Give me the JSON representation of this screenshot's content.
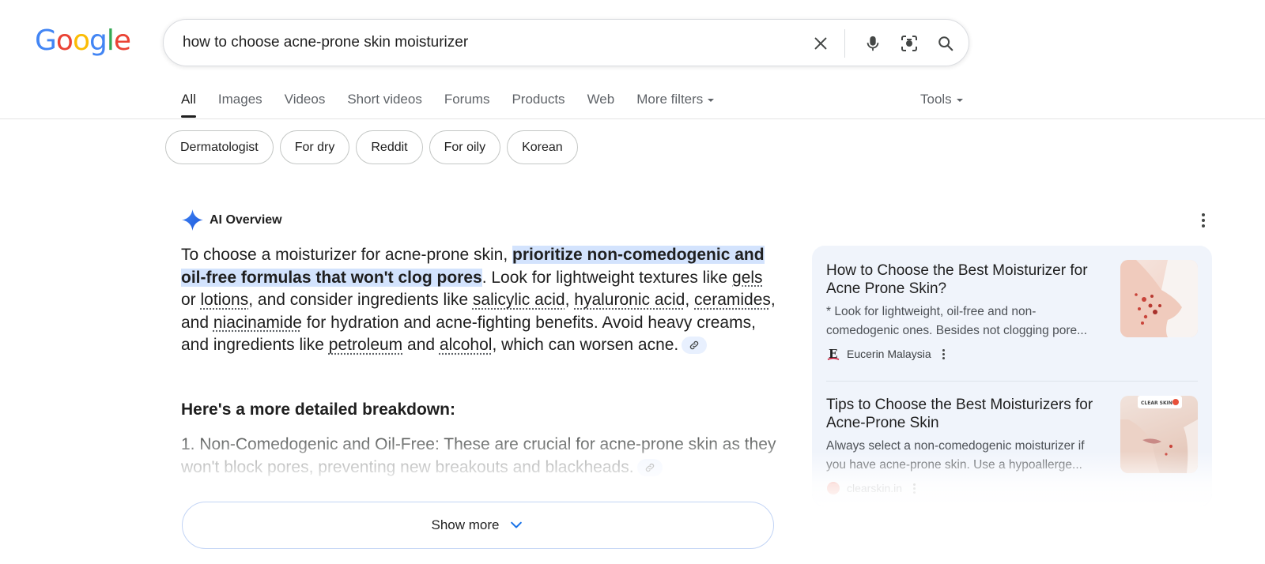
{
  "logo": {
    "letters": [
      "G",
      "o",
      "o",
      "g",
      "l",
      "e"
    ],
    "colors": [
      "#4285F4",
      "#EA4335",
      "#FBBC05",
      "#4285F4",
      "#34A853",
      "#EA4335"
    ]
  },
  "search": {
    "query": "how to choose acne-prone skin moisturizer",
    "icons": [
      "close-icon",
      "mic-icon",
      "lens-icon",
      "search-icon"
    ]
  },
  "tabs": [
    "All",
    "Images",
    "Videos",
    "Short videos",
    "Forums",
    "Products",
    "Web",
    "More filters"
  ],
  "tools_label": "Tools",
  "chips": [
    "Dermatologist",
    "For dry",
    "Reddit",
    "For oily",
    "Korean"
  ],
  "ai_overview": {
    "title": "AI Overview",
    "intro": "To choose a moisturizer for acne-prone skin, ",
    "highlight": "prioritize non-comedogenic and oil-free formulas that won't clog pores",
    "p1": ". Look for lightweight textures like ",
    "gels": "gels",
    "or": " or ",
    "lotions": "lotions",
    "p2": ", and consider ingredients like ",
    "salicylic": "salicylic acid",
    "comma1": ", ",
    "hyaluronic": "hyaluronic acid",
    "comma2": ", ",
    "ceramides": "ceramides",
    "and1": ", and ",
    "niacinamide": "niacinamide",
    "p3": " for hydration and acne-fighting benefits. Avoid heavy creams, and ingredients like ",
    "petroleum": "petroleum",
    "and2": " and ",
    "alcohol": "alcohol",
    "p4": ", which can worsen acne.",
    "subheading": "Here's a more detailed breakdown:",
    "item1": "1. Non-Comedogenic and Oil-Free: These are crucial for acne-prone skin as they won't block pores, preventing new breakouts and blackheads.",
    "show_more": "Show more",
    "accent": "#1a73e8",
    "highlight_bg": "#d3e3fd"
  },
  "sources": [
    {
      "title": "How to Choose the Best Moisturizer for Acne Prone Skin?",
      "snippet_l1": "* Look for lightweight, oil-free and non-",
      "snippet_l2": "comedogenic ones. Besides not clogging pore...",
      "source": "Eucerin Malaysia",
      "favicon_letter": "E"
    },
    {
      "title": "Tips to Choose the Best Moisturizers for Acne-Prone Skin",
      "snippet_l1": "Always select a non-comedogenic moisturizer if",
      "snippet_l2": "you have acne-prone skin. Use a hypoallerge...",
      "source": "clearskin.in",
      "thumb_label": "CLEAR SKIN"
    }
  ]
}
